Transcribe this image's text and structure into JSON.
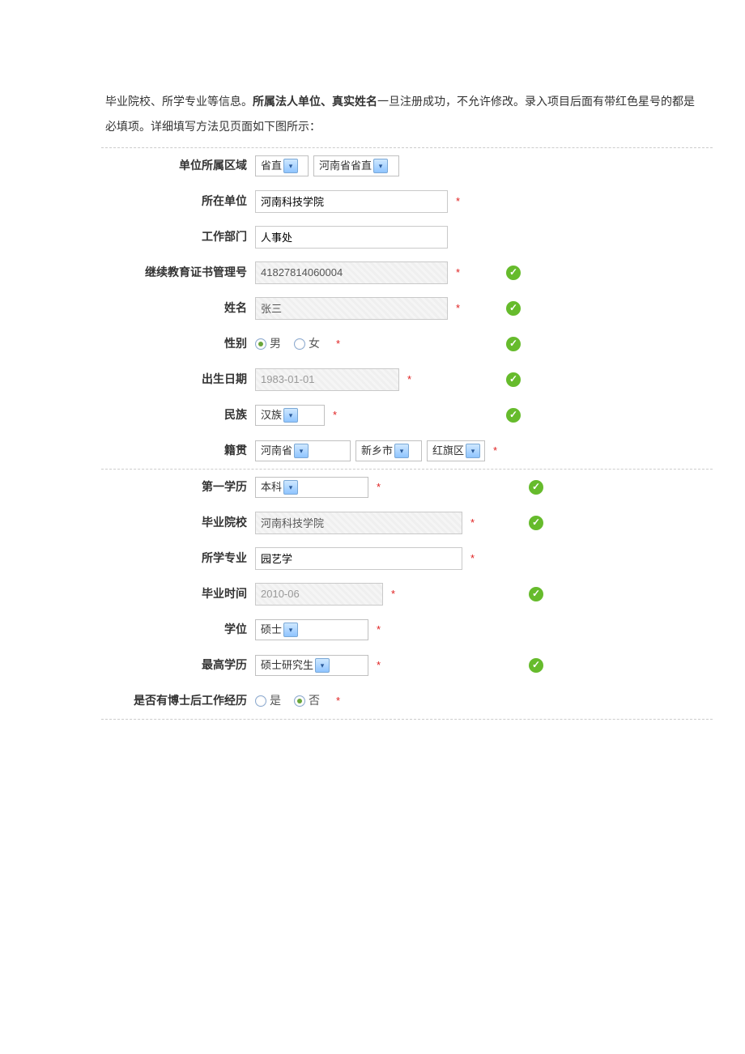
{
  "intro": {
    "prefix": "毕业院校、所学专业等信息。",
    "bold": "所属法人单位、真实姓名",
    "suffix": "一旦注册成功，不允许修改。录入项目后面有带红色星号的都是必填项。详细填写方法见页面如下图所示："
  },
  "labels": {
    "region": "单位所属区域",
    "unit": "所在单位",
    "dept": "工作部门",
    "certno": "继续教育证书管理号",
    "name": "姓名",
    "gender": "性别",
    "birth": "出生日期",
    "nation": "民族",
    "native": "籍贯",
    "firstedu": "第一学历",
    "school": "毕业院校",
    "major": "所学专业",
    "gradtime": "毕业时间",
    "degree": "学位",
    "highedu": "最高学历",
    "postdoc": "是否有博士后工作经历"
  },
  "values": {
    "region1": "省直",
    "region2": "河南省省直",
    "unit": "河南科技学院",
    "dept": "人事处",
    "certno": "41827814060004",
    "name": "张三",
    "gender_male": "男",
    "gender_female": "女",
    "birth": "1983-01-01",
    "nation": "汉族",
    "native_prov": "河南省",
    "native_city": "新乡市",
    "native_dist": "红旗区",
    "firstedu": "本科",
    "school": "河南科技学院",
    "major": "园艺学",
    "gradtime": "2010-06",
    "degree": "硕士",
    "highedu": "硕士研究生",
    "postdoc_yes": "是",
    "postdoc_no": "否"
  }
}
